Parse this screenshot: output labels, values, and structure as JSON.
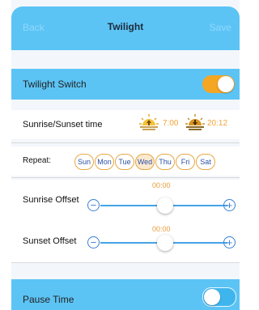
{
  "header": {
    "back_label": "Back",
    "title": "Twilight",
    "save_label": "Save"
  },
  "twilight_switch": {
    "label": "Twilight Switch",
    "on": true
  },
  "sunrise_sunset": {
    "label": "Sunrise/Sunset time",
    "sunrise": "7:00",
    "sunset": "20:12",
    "sunrise_icon": "sunrise-icon",
    "sunset_icon": "sunset-icon"
  },
  "repeat": {
    "label": "Repeat:",
    "days": [
      {
        "label": "Sun",
        "selected": false
      },
      {
        "label": "Mon",
        "selected": false
      },
      {
        "label": "Tue",
        "selected": false
      },
      {
        "label": "Wed",
        "selected": true
      },
      {
        "label": "Thu",
        "selected": false
      },
      {
        "label": "Fri",
        "selected": false
      },
      {
        "label": "Sat",
        "selected": false
      }
    ]
  },
  "sunrise_offset": {
    "label": "Sunrise Offset",
    "value": "00:00",
    "minus": "−",
    "plus": "+"
  },
  "sunset_offset": {
    "label": "Sunset Offset",
    "value": "00:00",
    "minus": "−",
    "plus": "+"
  },
  "pause_time": {
    "label": "Pause Time",
    "on": false
  },
  "colors": {
    "header": "#5cc4f5",
    "accent": "#f5a623",
    "day_border": "#e6a845",
    "slider": "#45a3e6"
  }
}
